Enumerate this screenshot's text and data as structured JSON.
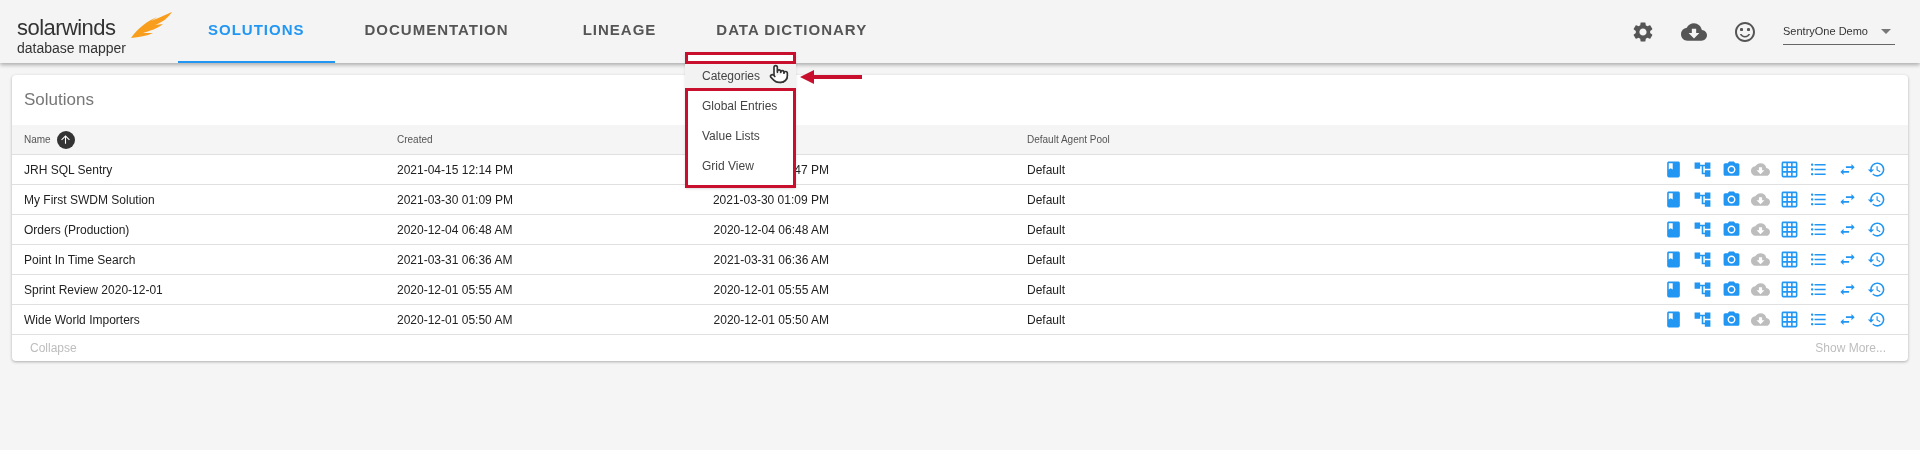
{
  "header": {
    "logo": {
      "brand": "solarwinds",
      "product": "database mapper"
    },
    "tabs": [
      {
        "label": "SOLUTIONS",
        "selected": true
      },
      {
        "label": "DOCUMENTATION",
        "selected": false
      },
      {
        "label": "LINEAGE",
        "selected": false
      },
      {
        "label": "DATA DICTIONARY",
        "selected": false
      }
    ],
    "account": "SentryOne Demo"
  },
  "menu": {
    "items": [
      {
        "label": "Categories",
        "selected": true
      },
      {
        "label": "Global Entries",
        "selected": false
      },
      {
        "label": "Value Lists",
        "selected": false
      },
      {
        "label": "Grid View",
        "selected": false
      }
    ]
  },
  "solutions": {
    "title": "Solutions",
    "columns": [
      "Name",
      "Created",
      "Default Agent Pool"
    ],
    "row_actions": [
      {
        "kind": "book",
        "disabled": false
      },
      {
        "kind": "hierarchy",
        "disabled": false
      },
      {
        "kind": "camera",
        "disabled": false
      },
      {
        "kind": "cloud",
        "disabled": true
      },
      {
        "kind": "grid",
        "disabled": false
      },
      {
        "kind": "list",
        "disabled": false
      },
      {
        "kind": "swap",
        "disabled": false
      },
      {
        "kind": "history",
        "disabled": false
      }
    ],
    "rows": [
      {
        "name": "JRH SQL Sentry",
        "created": "2021-04-15 12:14 PM",
        "column_3": "47 PM",
        "pool": "Default"
      },
      {
        "name": "My First SWDM Solution",
        "created": "2021-03-30 01:09 PM",
        "column_3": "2021-03-30 01:09 PM",
        "pool": "Default"
      },
      {
        "name": "Orders (Production)",
        "created": "2020-12-04 06:48 AM",
        "column_3": "2020-12-04 06:48 AM",
        "pool": "Default"
      },
      {
        "name": "Point In Time Search",
        "created": "2021-03-31 06:36 AM",
        "column_3": "2021-03-31 06:36 AM",
        "pool": "Default"
      },
      {
        "name": "Sprint Review 2020-12-01",
        "created": "2020-12-01 05:55 AM",
        "column_3": "2020-12-01 05:55 AM",
        "pool": "Default"
      },
      {
        "name": "Wide World Importers",
        "created": "2020-12-01 05:50 AM",
        "column_3": "2020-12-01 05:50 AM",
        "pool": "Default"
      }
    ],
    "collapse": "Collapse",
    "show_more": "Show More..."
  }
}
